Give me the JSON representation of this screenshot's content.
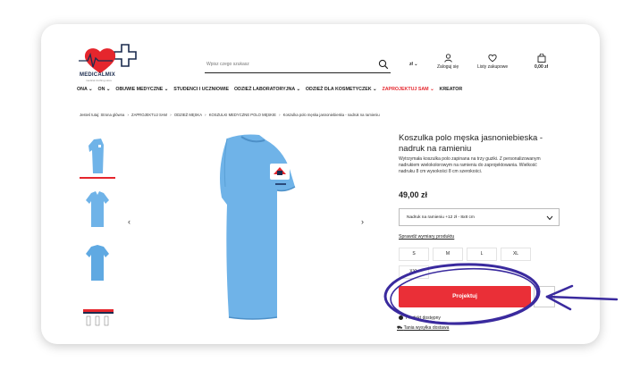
{
  "brand": {
    "logo_text": "MEDICALMIX",
    "logo_sub": "medical clothing store"
  },
  "search": {
    "placeholder": "Wpisz czego szukasz"
  },
  "header": {
    "currency": "zł ⌄",
    "login_label": "Zaloguj się",
    "wishlist_label": "Listy zakupowe",
    "cart_label": "0,00 zł"
  },
  "nav": {
    "items": [
      "ONA ⌄",
      "ON ⌄",
      "OBUWIE MEDYCZNE ⌄",
      "STUDENCI I UCZNIOWIE",
      "ODZIEŻ LABORATORYJNA ⌄",
      "ODZIEŻ DLA KOSMETYCZEK ⌄",
      "ZAPROJEKTUJ SAM ⌄",
      "KREATOR"
    ]
  },
  "breadcrumb": {
    "items": [
      "Jesteś tutaj: Strona główna",
      "›",
      "ZAPROJEKTUJ SAM",
      "›",
      "ODZIEŻ MĘSKA",
      "›",
      "KOSZULKI MEDYCZNE POLO MĘSKIE",
      "›",
      "Koszulka polo męska jasnoniebieska - nadruk na ramieniu"
    ]
  },
  "product": {
    "title": "Koszulka polo męska jasnoniebieska - nadruk na ramieniu",
    "description": "Wytrzymała koszulka polo zapinana na trzy guziki. Z personalizowanym nadrukiem wielokolorowym na ramieniu do zaprojektowania. Wielkość nadruku 8 cm wysokości 8 cm szerokości.",
    "price": "49,00 zł",
    "option_selected": "Nadruk na ramieniu +12 zł - 8x8 cm",
    "size_link": "Sprawdź wymiary produktu",
    "sizes": [
      "S",
      "M",
      "L",
      "XL",
      "XXL"
    ],
    "button_label": "Projektuj",
    "availability": "Produkt dostępny",
    "shipping": "Tania wysyłka dostawa"
  },
  "colors": {
    "accent": "#ea2f37",
    "shirt": "#6fb3e8",
    "annotation": "#3a2a9e"
  }
}
